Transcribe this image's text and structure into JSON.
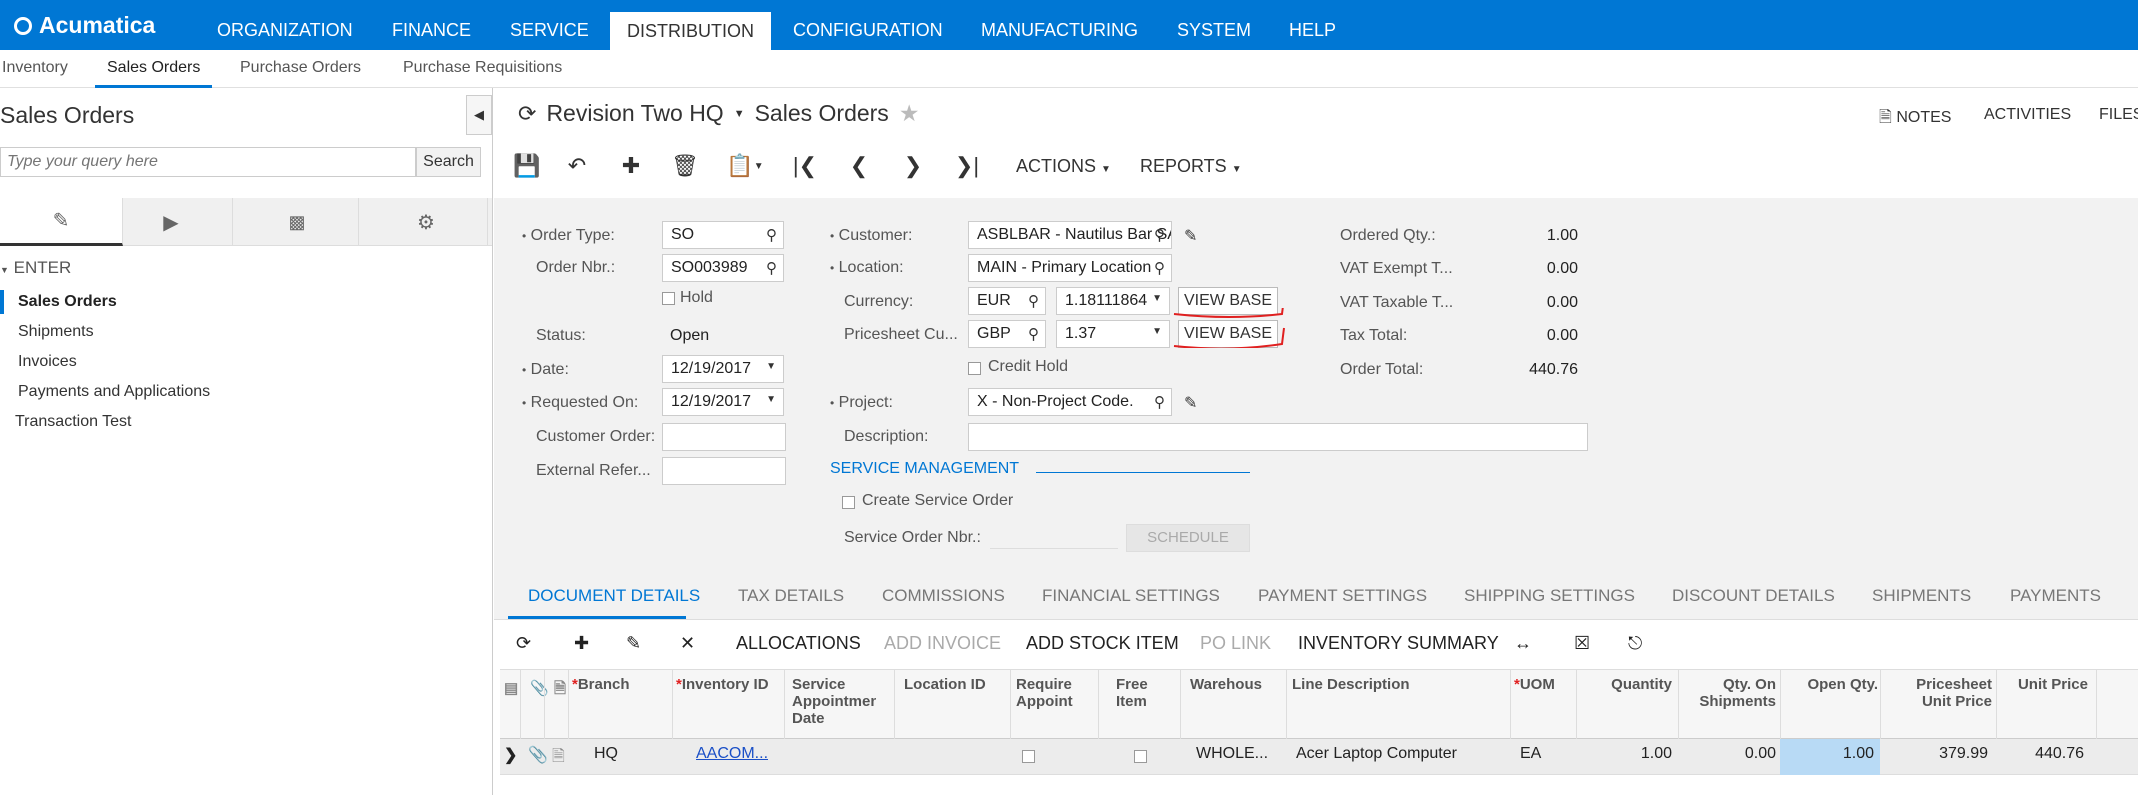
{
  "app": {
    "brand": "Acumatica",
    "accent": "#0077d4"
  },
  "topnav": [
    "ORGANIZATION",
    "FINANCE",
    "SERVICE",
    "DISTRIBUTION",
    "CONFIGURATION",
    "MANUFACTURING",
    "SYSTEM",
    "HELP"
  ],
  "subnav": [
    "Inventory",
    "Sales Orders",
    "Purchase Orders",
    "Purchase Requisitions"
  ],
  "left": {
    "title": "Sales Orders",
    "search_placeholder": "Type your query here",
    "search_button": "Search",
    "section": "ENTER",
    "items": [
      "Sales Orders",
      "Shipments",
      "Invoices",
      "Payments and Applications",
      "Transaction Test"
    ]
  },
  "header": {
    "company": "Revision Two HQ",
    "screen": "Sales Orders",
    "notes": "NOTES",
    "activities": "ACTIVITIES",
    "files": "FILES",
    "actions": "ACTIONS",
    "reports": "REPORTS"
  },
  "form": {
    "order_type_label": "Order Type:",
    "order_type": "SO",
    "order_nbr_label": "Order Nbr.:",
    "order_nbr": "SO003989",
    "hold_label": "Hold",
    "status_label": "Status:",
    "status": "Open",
    "date_label": "Date:",
    "date": "12/19/2017",
    "requested_on_label": "Requested On:",
    "requested_on": "12/19/2017",
    "customer_order_label": "Customer Order:",
    "external_ref_label": "External Refer...",
    "customer_label": "Customer:",
    "customer": "ASBLBAR - Nautilus Bar SABL",
    "location_label": "Location:",
    "location": "MAIN - Primary Location",
    "currency_label": "Currency:",
    "currency": "EUR",
    "currency_rate": "1.18111864",
    "pricesheet_label": "Pricesheet Cu...",
    "pricesheet_currency": "GBP",
    "pricesheet_rate": "1.37",
    "view_base": "VIEW BASE",
    "credit_hold_label": "Credit Hold",
    "project_label": "Project:",
    "project": "X - Non-Project Code.",
    "description_label": "Description:",
    "service_mgmt": "SERVICE MANAGEMENT",
    "create_service_order": "Create Service Order",
    "service_order_nbr_label": "Service Order Nbr.:",
    "schedule": "SCHEDULE",
    "ordered_qty_label": "Ordered Qty.:",
    "ordered_qty": "1.00",
    "vat_exempt_label": "VAT Exempt T...",
    "vat_exempt": "0.00",
    "vat_taxable_label": "VAT Taxable T...",
    "vat_taxable": "0.00",
    "tax_total_label": "Tax Total:",
    "tax_total": "0.00",
    "order_total_label": "Order Total:",
    "order_total": "440.76"
  },
  "tabs": [
    "DOCUMENT DETAILS",
    "TAX DETAILS",
    "COMMISSIONS",
    "FINANCIAL SETTINGS",
    "PAYMENT SETTINGS",
    "SHIPPING SETTINGS",
    "DISCOUNT DETAILS",
    "SHIPMENTS",
    "PAYMENTS"
  ],
  "grid_toolbar": [
    "ALLOCATIONS",
    "ADD INVOICE",
    "ADD STOCK ITEM",
    "PO LINK",
    "INVENTORY SUMMARY"
  ],
  "grid": {
    "headers": [
      "Branch",
      "Inventory ID",
      "Service Appointment Date",
      "Location ID",
      "Require Appoint",
      "Free Item",
      "Warehous",
      "Line Description",
      "UOM",
      "Quantity",
      "Qty. On Shipments",
      "Open Qty.",
      "Pricesheet Unit Price",
      "Unit Price"
    ],
    "row": {
      "branch": "HQ",
      "inventory_id": "AACOM...",
      "warehouse": "WHOLE...",
      "line_description": "Acer Laptop Computer",
      "uom": "EA",
      "quantity": "1.00",
      "qty_on_shipments": "0.00",
      "open_qty": "1.00",
      "pricesheet_unit_price": "379.99",
      "unit_price": "440.76"
    }
  }
}
